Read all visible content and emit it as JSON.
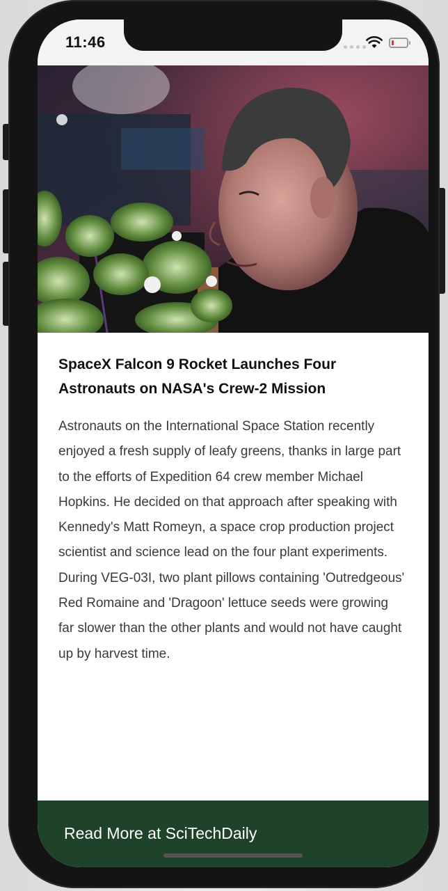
{
  "status_bar": {
    "time": "11:46"
  },
  "hero": {
    "image_description_icon": "astronaut-with-plants-photo"
  },
  "article": {
    "title": "SpaceX Falcon 9 Rocket Launches Four Astronauts on NASA's Crew-2 Mission",
    "body": "Astronauts on the International Space Station recently enjoyed a fresh supply of leafy greens, thanks in large part to the efforts of Expedition 64 crew member Michael Hopkins. He decided on that approach after speaking with Kennedy's Matt Romeyn, a space crop production project scientist and science lead on the four plant experiments. During VEG-03I, two plant pillows containing 'Outredgeous' Red Romaine and 'Dragoon' lettuce seeds were growing far slower than the other plants and would not have caught up by harvest time."
  },
  "footer": {
    "link_label": "Read More at SciTechDaily"
  },
  "colors": {
    "footer_bg": "#1e4328",
    "status_bar_bg": "#f3f3f3",
    "battery_low": "#e5322d"
  }
}
